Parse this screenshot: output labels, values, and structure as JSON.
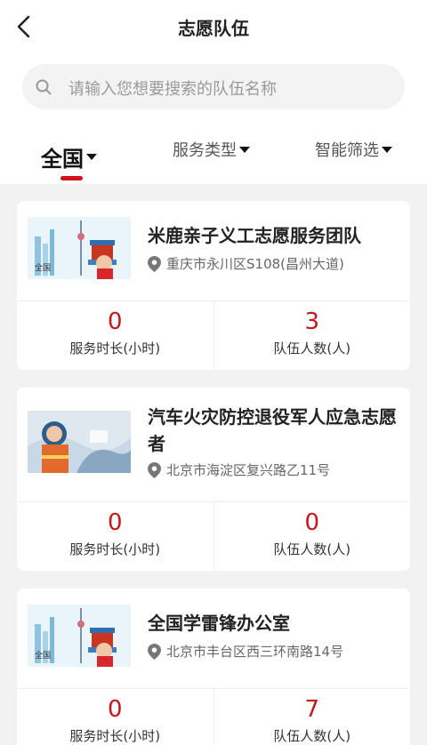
{
  "header": {
    "title": "志愿队伍"
  },
  "search": {
    "placeholder": "请输入您想要搜索的队伍名称"
  },
  "filters": [
    {
      "label": "全国"
    },
    {
      "label": "服务类型"
    },
    {
      "label": "智能筛选"
    }
  ],
  "colors": {
    "accent": "#c8161d",
    "underline": "#d0121b"
  },
  "teams": [
    {
      "name": "米鹿亲子义工志愿服务团队",
      "address": "重庆市永川区S108(昌州大道)",
      "service_hours": "0",
      "members": "3",
      "hours_label": "服务时长(小时)",
      "members_label": "队伍人数(人)",
      "thumb_caption": "全国"
    },
    {
      "name": "汽车火灾防控退役军人应急志愿者",
      "address": "北京市海淀区复兴路乙11号",
      "service_hours": "0",
      "members": "0",
      "hours_label": "服务时长(小时)",
      "members_label": "队伍人数(人)"
    },
    {
      "name": "全国学雷锋办公室",
      "address": "北京市丰台区西三环南路14号",
      "service_hours": "0",
      "members": "7",
      "hours_label": "服务时长(小时)",
      "members_label": "队伍人数(人)",
      "thumb_caption": "全国"
    }
  ]
}
